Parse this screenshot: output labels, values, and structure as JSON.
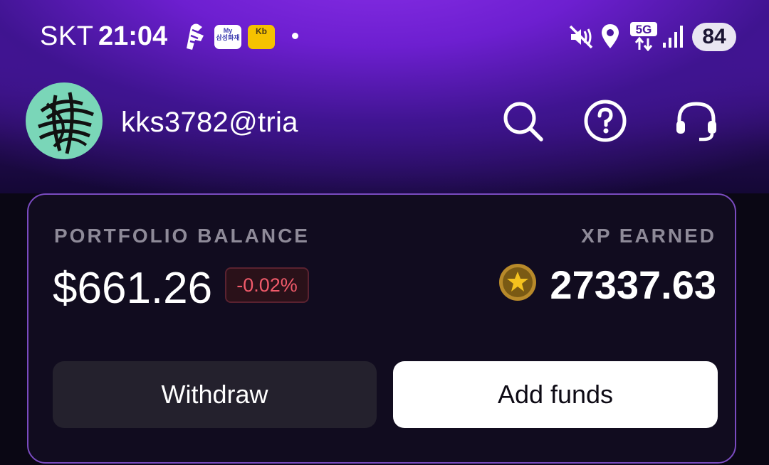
{
  "status_bar": {
    "carrier": "SKT",
    "time": "21:04",
    "notification_apps": [
      {
        "name": "shoe-app-icon"
      },
      {
        "name": "samsung-fire-app-icon",
        "label_top": "My",
        "label_bottom": "삼성화재"
      },
      {
        "name": "kb-app-icon",
        "label": "Kb"
      }
    ],
    "network": "5G",
    "battery": "84",
    "icons": [
      "shoe-icon",
      "mute-vibrate-icon",
      "location-icon",
      "5g-data-icon",
      "signal-icon"
    ]
  },
  "header": {
    "username": "kks3782@tria",
    "actions": [
      {
        "name": "search-button",
        "icon": "search-icon"
      },
      {
        "name": "help-button",
        "icon": "help-circle-icon"
      },
      {
        "name": "support-button",
        "icon": "headset-icon"
      }
    ]
  },
  "card": {
    "portfolio_label": "PORTFOLIO BALANCE",
    "balance": "$661.26",
    "change": "-0.02%",
    "xp_label": "XP EARNED",
    "xp_value": "27337.63",
    "withdraw_label": "Withdraw",
    "add_funds_label": "Add funds"
  },
  "colors": {
    "accent_purple": "#7a2fe0",
    "negative_change": "#f05a6a",
    "card_border": "#7a4bc0",
    "coin_gold": "#e8b820"
  }
}
